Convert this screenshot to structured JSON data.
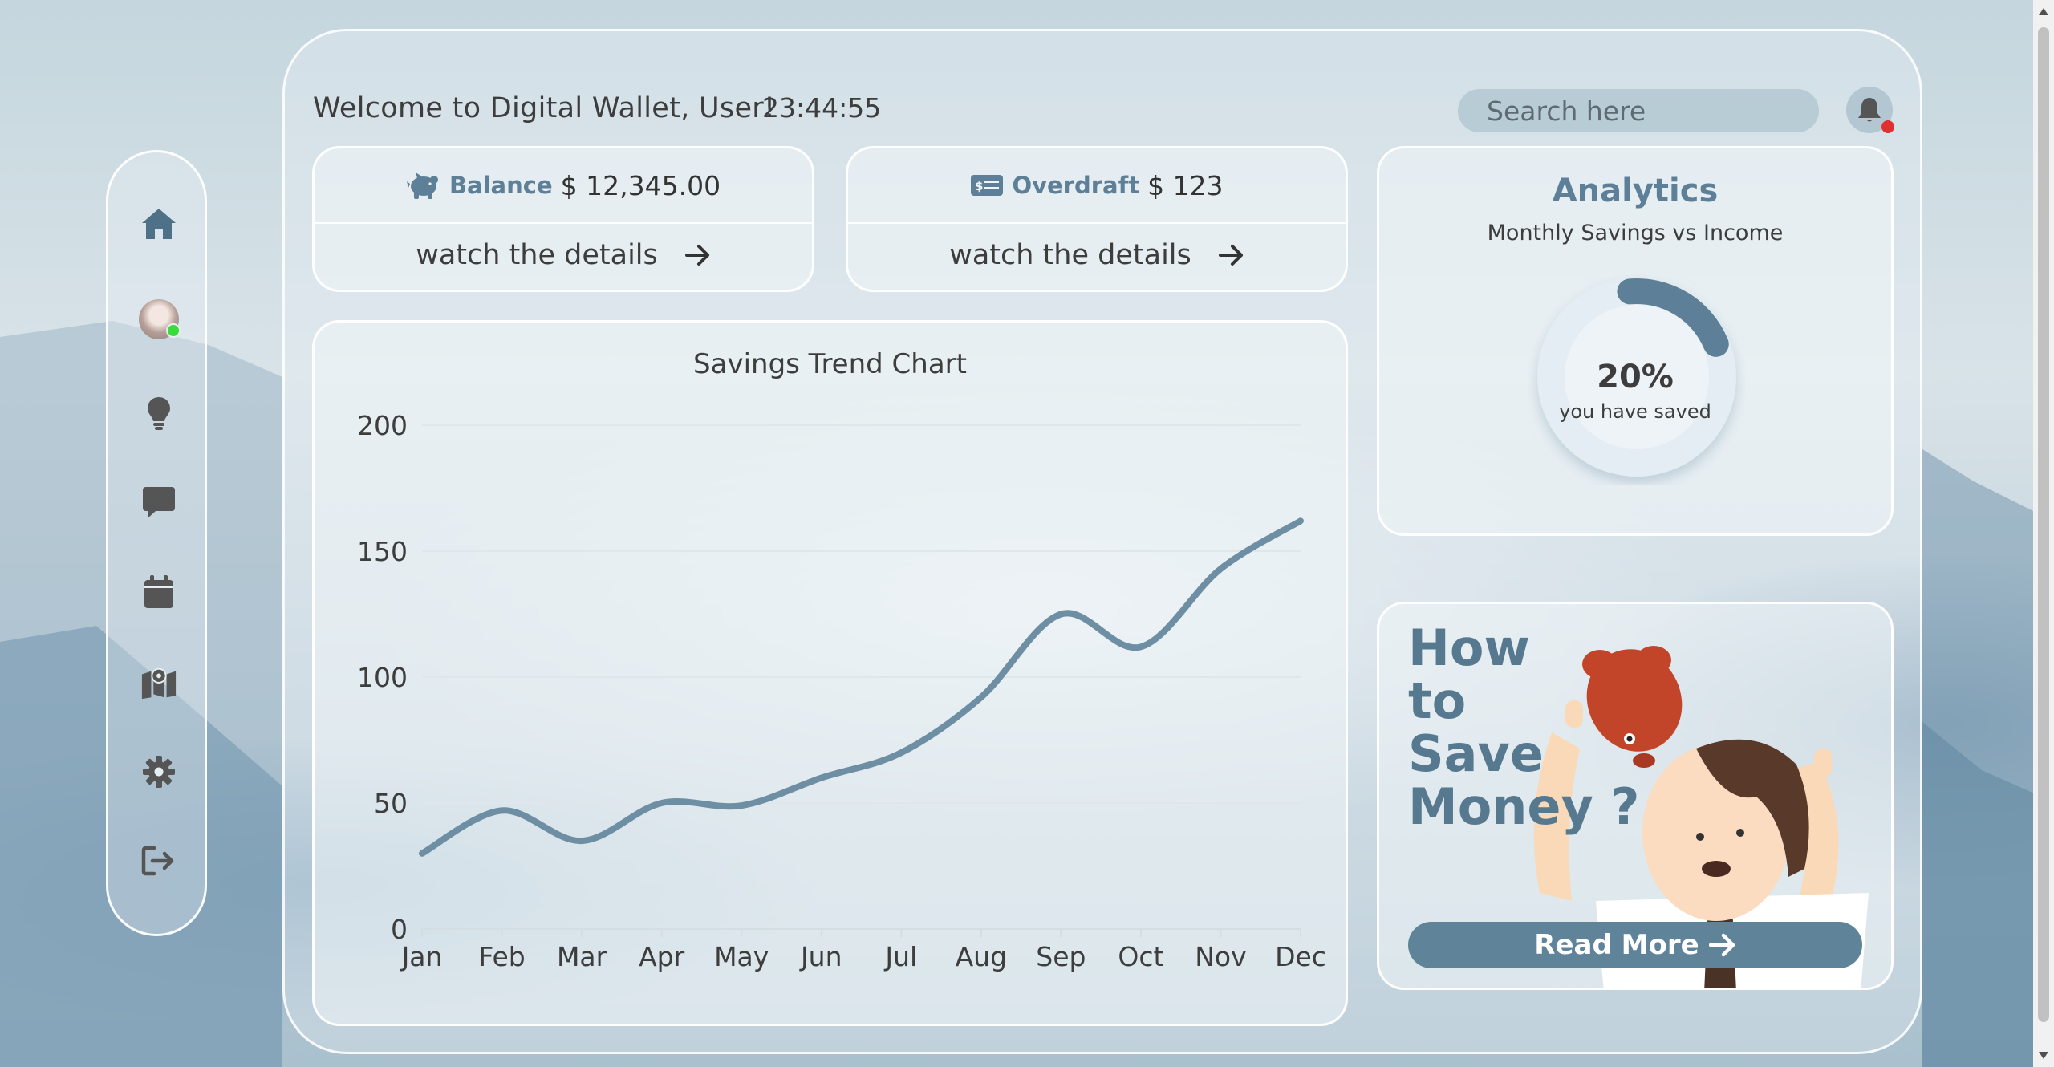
{
  "header": {
    "welcome": "Welcome to Digital Wallet, User!",
    "time": "23:44:55",
    "search_placeholder": "Search here",
    "notification_badge_color": "#e03030"
  },
  "sidebar": {
    "items": [
      {
        "icon": "home-icon"
      },
      {
        "icon": "avatar"
      },
      {
        "icon": "lightbulb-icon"
      },
      {
        "icon": "chat-icon"
      },
      {
        "icon": "calendar-icon"
      },
      {
        "icon": "map-icon"
      },
      {
        "icon": "gear-icon"
      },
      {
        "icon": "logout-icon"
      }
    ],
    "icon_color": "#4f7187"
  },
  "cards": {
    "balance": {
      "label": "Balance",
      "value": "$ 12,345.00",
      "link": "watch the details",
      "icon": "piggy-bank-icon"
    },
    "overdraft": {
      "label": "Overdraft",
      "value": "$ 123",
      "link": "watch the details",
      "icon": "money-bill-icon"
    }
  },
  "analytics": {
    "title": "Analytics",
    "subtitle": "Monthly Savings vs Income",
    "percent_label": "20%",
    "caption": "you have saved",
    "percent": 20,
    "accent": "#5d8098"
  },
  "promo": {
    "title_lines": [
      "How",
      "to",
      "Save",
      "Money ?"
    ],
    "button": "Read More"
  },
  "chart_data": {
    "type": "line",
    "title": "Savings Trend Chart",
    "categories": [
      "Jan",
      "Feb",
      "Mar",
      "Apr",
      "May",
      "Jun",
      "Jul",
      "Aug",
      "Sep",
      "Oct",
      "Nov",
      "Dec"
    ],
    "values": [
      30,
      47,
      35,
      50,
      49,
      60,
      70,
      92,
      125,
      112,
      143,
      162
    ],
    "ylim": [
      0,
      200
    ],
    "yticks": [
      "0",
      "50",
      "100",
      "150",
      "200"
    ],
    "grid": true,
    "line_color": "#6e8fa3"
  }
}
